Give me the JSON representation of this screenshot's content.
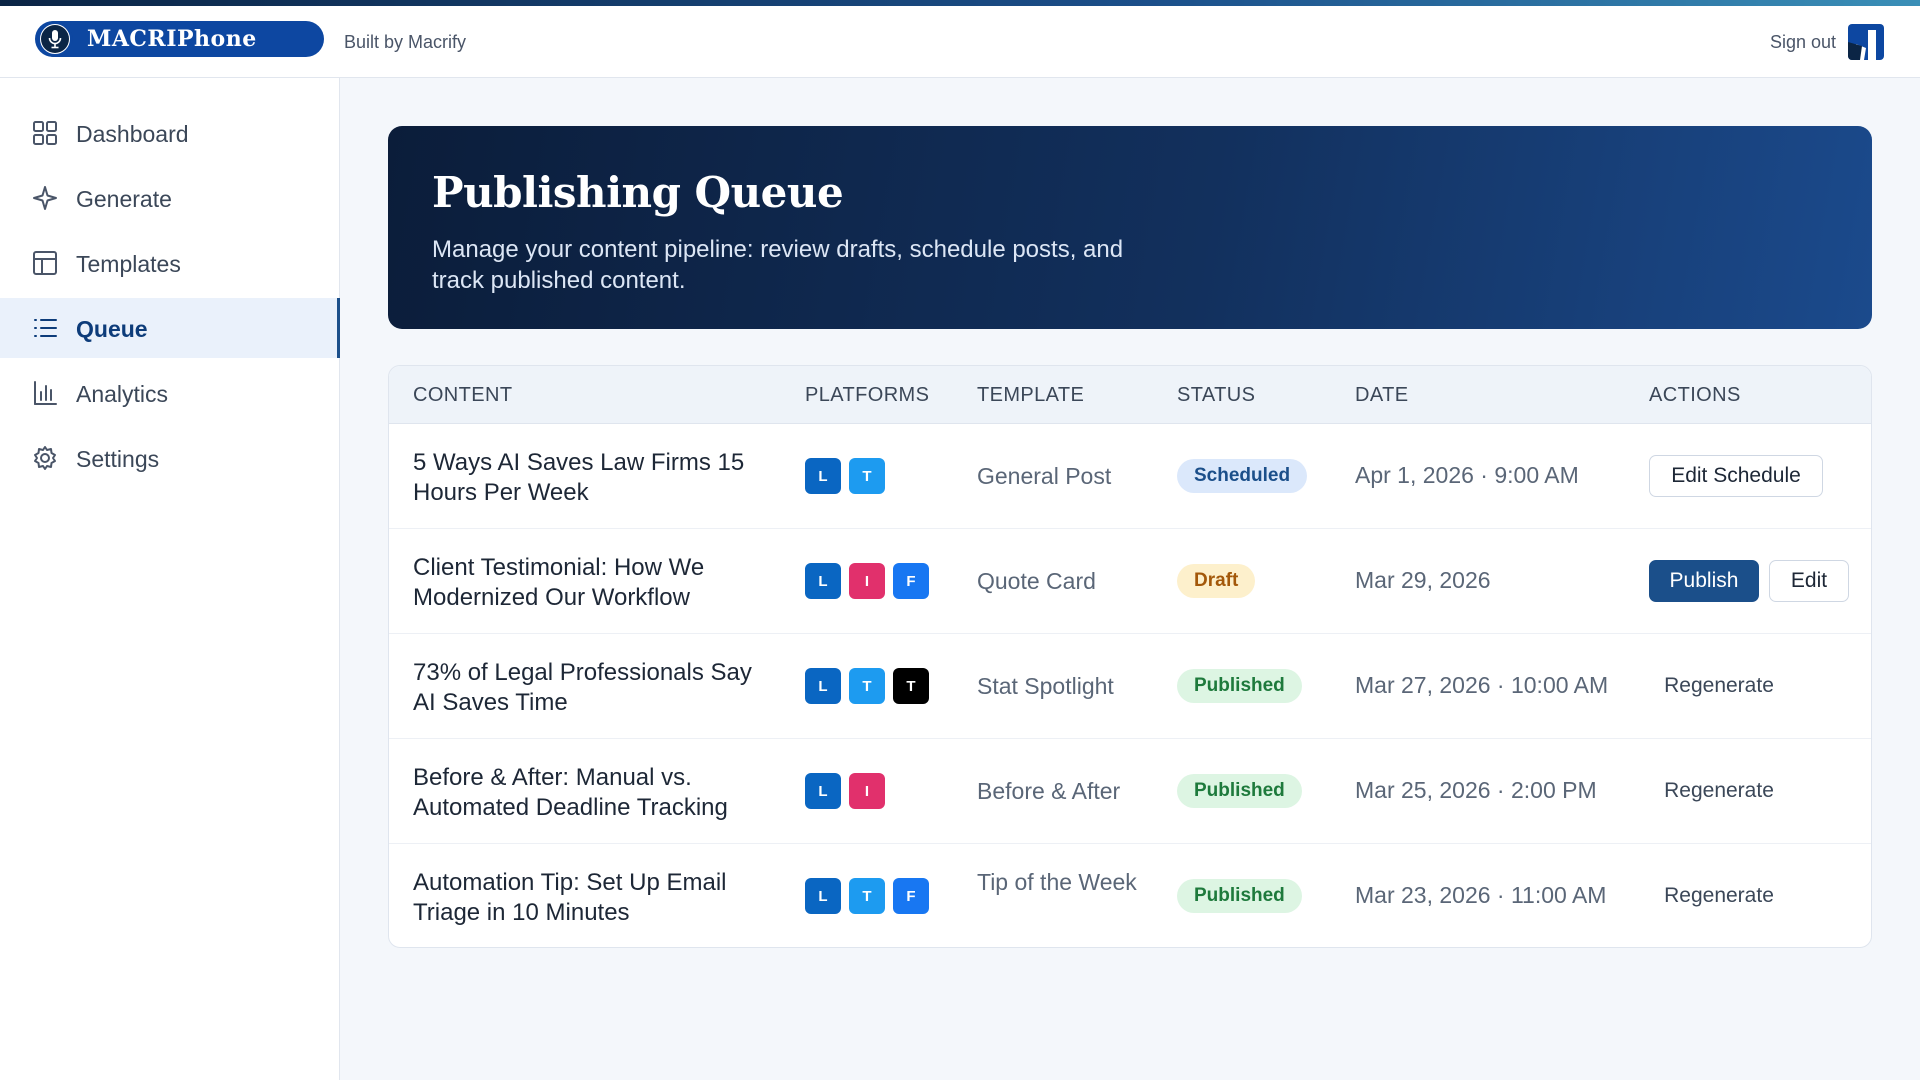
{
  "app": {
    "logo_text": "MACRIPhone",
    "built_by": "Built by Macrify",
    "sign_out": "Sign out"
  },
  "colors": {
    "accent": "#1b4f8a",
    "hero_start": "#0b1d3a",
    "hero_end": "#1b4a8c",
    "linkedin": "#0a66c2",
    "twitter": "#1d9bf0",
    "instagram": "#e1306c",
    "facebook": "#1877f2",
    "x": "#000000"
  },
  "sidebar": {
    "items": [
      {
        "label": "Dashboard",
        "icon": "grid-icon",
        "active": false
      },
      {
        "label": "Generate",
        "icon": "sparkle-icon",
        "active": false
      },
      {
        "label": "Templates",
        "icon": "layout-icon",
        "active": false
      },
      {
        "label": "Queue",
        "icon": "list-icon",
        "active": true
      },
      {
        "label": "Analytics",
        "icon": "bar-chart-icon",
        "active": false
      },
      {
        "label": "Settings",
        "icon": "gear-icon",
        "active": false
      }
    ]
  },
  "hero": {
    "title": "Publishing Queue",
    "subtitle": "Manage your content pipeline: review drafts, schedule posts, and track published content."
  },
  "table": {
    "headers": {
      "content": "CONTENT",
      "platforms": "PLATFORMS",
      "template": "TEMPLATE",
      "status": "STATUS",
      "date": "DATE",
      "actions": "ACTIONS"
    },
    "rows": [
      {
        "content": "5 Ways AI Saves Law Firms 15 Hours Per Week",
        "platforms": [
          "L",
          "T"
        ],
        "template": "General Post",
        "status": "Scheduled",
        "date": "Apr 1, 2026 · 9:00 AM",
        "actions": [
          "Edit Schedule"
        ]
      },
      {
        "content": "Client Testimonial: How We Modernized Our Workflow",
        "platforms": [
          "L",
          "I",
          "F"
        ],
        "template": "Quote Card",
        "status": "Draft",
        "date": "Mar 29, 2026",
        "actions": [
          "Publish",
          "Edit"
        ]
      },
      {
        "content": "73% of Legal Professionals Say AI Saves Time",
        "platforms": [
          "L",
          "T",
          "T"
        ],
        "template": "Stat Spotlight",
        "status": "Published",
        "date": "Mar 27, 2026 · 10:00 AM",
        "actions": [
          "Regenerate"
        ]
      },
      {
        "content": "Before & After: Manual vs. Automated Deadline Tracking",
        "platforms": [
          "L",
          "I"
        ],
        "template": "Before & After",
        "status": "Published",
        "date": "Mar 25, 2026 · 2:00 PM",
        "actions": [
          "Regenerate"
        ]
      },
      {
        "content": "Automation Tip: Set Up Email Triage in 10 Minutes",
        "platforms": [
          "L",
          "T",
          "F"
        ],
        "template": "Tip of the Week",
        "status": "Published",
        "date": "Mar 23, 2026 · 11:00 AM",
        "actions": [
          "Regenerate"
        ]
      }
    ]
  }
}
